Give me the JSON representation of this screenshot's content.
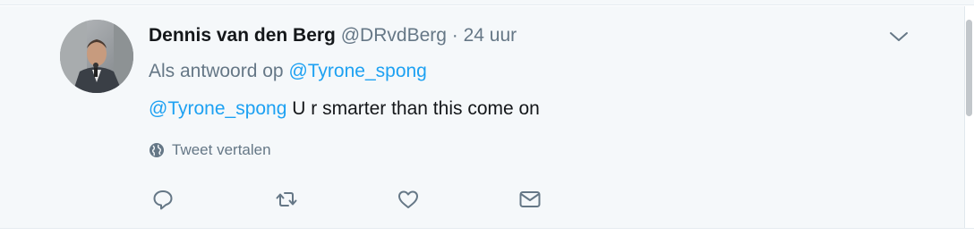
{
  "tweet": {
    "author": {
      "name": "Dennis van den Berg",
      "handle": "@DRvdBerg"
    },
    "separator": "·",
    "time": "24 uur",
    "reply_context": {
      "prefix": "Als antwoord op",
      "mention": "@Tyrone_spong"
    },
    "text": {
      "mention": "@Tyrone_spong",
      "body": "U r smarter than this come on"
    },
    "translate_label": "Tweet vertalen",
    "actions": [
      "reply-icon",
      "retweet-icon",
      "like-icon",
      "message-icon"
    ]
  },
  "colors": {
    "link": "#1da1f2",
    "secondary_text": "#657786",
    "primary_text": "#14171a",
    "tweet_background": "#f5f8fa"
  }
}
